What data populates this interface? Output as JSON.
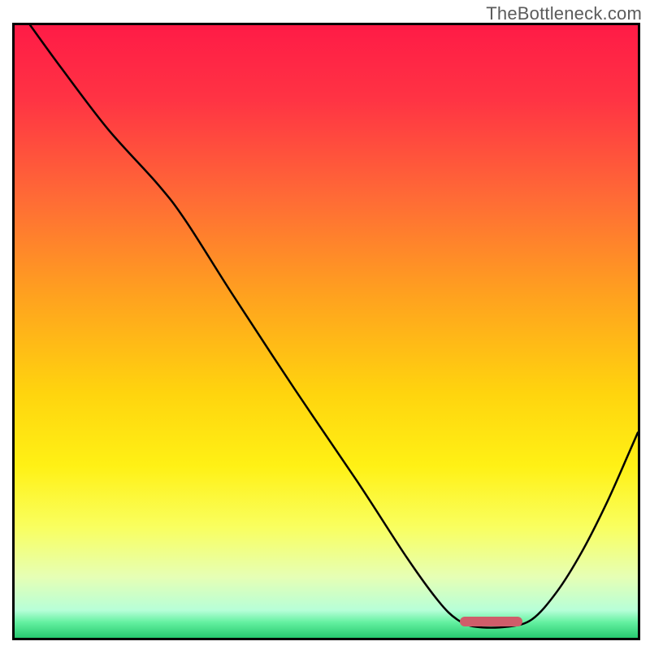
{
  "watermark": "TheBottleneck.com",
  "gradient": {
    "stops": [
      {
        "offset": 0.0,
        "color": "#ff1b46"
      },
      {
        "offset": 0.12,
        "color": "#ff3344"
      },
      {
        "offset": 0.28,
        "color": "#ff6a36"
      },
      {
        "offset": 0.44,
        "color": "#ffa11f"
      },
      {
        "offset": 0.6,
        "color": "#ffd40e"
      },
      {
        "offset": 0.72,
        "color": "#fff115"
      },
      {
        "offset": 0.82,
        "color": "#f9ff60"
      },
      {
        "offset": 0.9,
        "color": "#e6ffb4"
      },
      {
        "offset": 0.955,
        "color": "#b7ffd8"
      },
      {
        "offset": 0.975,
        "color": "#63f0a0"
      },
      {
        "offset": 1.0,
        "color": "#27c96f"
      }
    ]
  },
  "marker": {
    "x_frac_left": 0.715,
    "x_frac_right": 0.815,
    "y_frac_center": 0.973,
    "color": "#cf5d6a"
  },
  "chart_data": {
    "type": "line",
    "title": "",
    "xlabel": "",
    "ylabel": "",
    "xlim": [
      0,
      1
    ],
    "ylim": [
      0,
      1
    ],
    "series": [
      {
        "name": "curve",
        "points": [
          {
            "x": 0.025,
            "y": 1.0
          },
          {
            "x": 0.075,
            "y": 0.93
          },
          {
            "x": 0.15,
            "y": 0.83
          },
          {
            "x": 0.23,
            "y": 0.74
          },
          {
            "x": 0.275,
            "y": 0.68
          },
          {
            "x": 0.35,
            "y": 0.56
          },
          {
            "x": 0.45,
            "y": 0.405
          },
          {
            "x": 0.55,
            "y": 0.255
          },
          {
            "x": 0.63,
            "y": 0.13
          },
          {
            "x": 0.68,
            "y": 0.06
          },
          {
            "x": 0.71,
            "y": 0.03
          },
          {
            "x": 0.74,
            "y": 0.018
          },
          {
            "x": 0.79,
            "y": 0.018
          },
          {
            "x": 0.83,
            "y": 0.03
          },
          {
            "x": 0.87,
            "y": 0.075
          },
          {
            "x": 0.91,
            "y": 0.14
          },
          {
            "x": 0.95,
            "y": 0.22
          },
          {
            "x": 0.985,
            "y": 0.3
          },
          {
            "x": 1.0,
            "y": 0.335
          }
        ]
      }
    ],
    "highlight_range_x": [
      0.715,
      0.815
    ]
  }
}
